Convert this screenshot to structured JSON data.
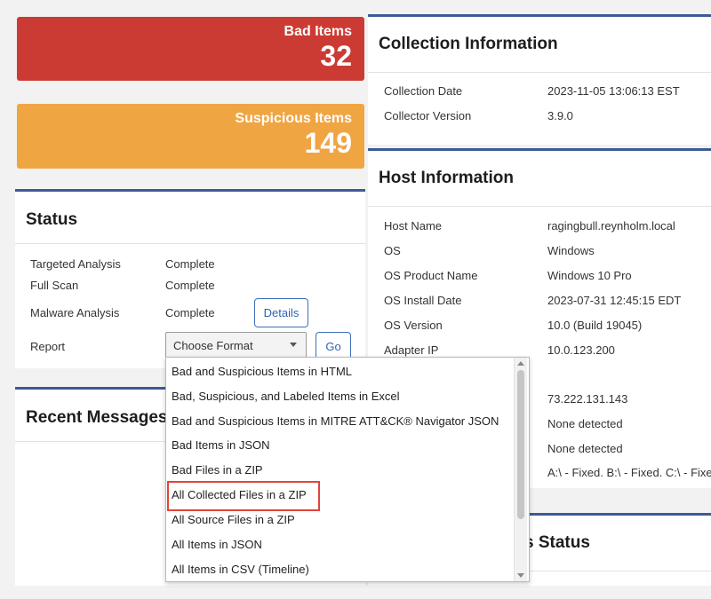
{
  "cards": {
    "bad": {
      "label": "Bad Items",
      "value": "32",
      "color": "#cc3b33"
    },
    "suspicious": {
      "label": "Suspicious Items",
      "value": "149",
      "color": "#f0a543"
    }
  },
  "status": {
    "title": "Status",
    "rows": [
      {
        "label": "Targeted Analysis",
        "value": "Complete"
      },
      {
        "label": "Full Scan",
        "value": "Complete"
      },
      {
        "label": "Malware Analysis",
        "value": "Complete"
      },
      {
        "label": "Report",
        "value": ""
      }
    ],
    "details_button": "Details",
    "report_select": "Choose Format",
    "go_button": "Go"
  },
  "recent_messages": {
    "title": "Recent Messages"
  },
  "collection": {
    "title": "Collection Information",
    "rows": [
      {
        "label": "Collection Date",
        "value": "2023-11-05 13:06:13 EST"
      },
      {
        "label": "Collector Version",
        "value": "3.9.0"
      }
    ]
  },
  "host": {
    "title": "Host Information",
    "rows": [
      {
        "label": "Host Name",
        "value": "ragingbull.reynholm.local"
      },
      {
        "label": "OS",
        "value": "Windows"
      },
      {
        "label": "OS Product Name",
        "value": "Windows 10 Pro"
      },
      {
        "label": "OS Install Date",
        "value": "2023-07-31 12:45:15 EDT"
      },
      {
        "label": "OS Version",
        "value": "10.0 (Build 19045)"
      },
      {
        "label": "Adapter IP",
        "value": "10.0.123.200"
      }
    ],
    "hidden_values": [
      "73.222.131.143",
      "None detected",
      "None detected",
      "A:\\ - Fixed. B:\\ - Fixed. C:\\ - Fixe"
    ]
  },
  "partial_panel_title": "s Status",
  "dropdown": {
    "options": [
      "Bad and Suspicious Items in HTML",
      "Bad, Suspicious, and Labeled Items in Excel",
      "Bad and Suspicious Items in MITRE ATT&CK® Navigator JSON",
      "Bad Items in JSON",
      "Bad Files in a ZIP",
      "All Collected Files in a ZIP",
      "All Source Files in a ZIP",
      "All Items in JSON",
      "All Items in CSV (Timeline)"
    ],
    "highlighted_index": 5,
    "highlight_color": "#e0443a"
  },
  "colors": {
    "accent": "#3b5b95",
    "button": "#3d6fb8"
  }
}
